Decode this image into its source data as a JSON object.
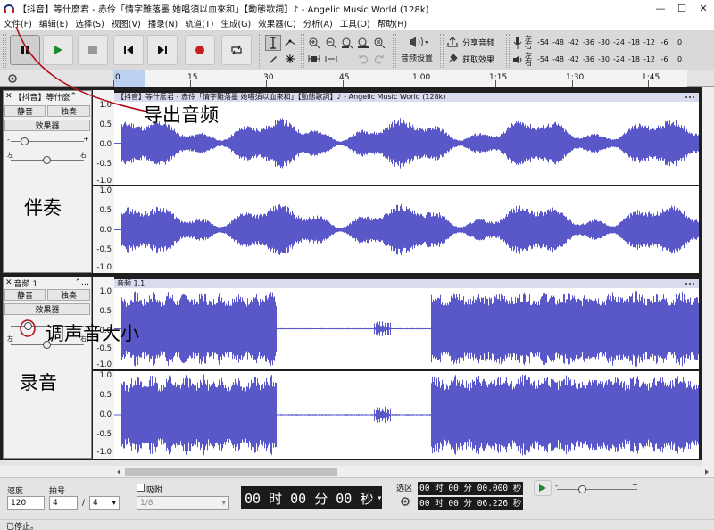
{
  "window": {
    "title": "【抖音】等什麼君 - 赤伶「情字難落墨 她唱須以血來和」【動態歌詞】♪ - Angelic Music World (128k)",
    "minimize": "—",
    "maximize": "☐",
    "close": "✕"
  },
  "menu": [
    "文件(F)",
    "编辑(E)",
    "选择(S)",
    "视图(V)",
    "播录(N)",
    "轨道(T)",
    "生成(G)",
    "效果器(C)",
    "分析(A)",
    "工具(O)",
    "帮助(H)"
  ],
  "toolbar": {
    "share_label": "分享音频",
    "effects_label": "获取效果",
    "audio_setup_label": "音频设置",
    "rec_meter": {
      "l": "左",
      "r": "右",
      "scale": [
        "-54",
        "-48",
        "-42",
        "-36",
        "-30",
        "-24",
        "-18",
        "-12",
        "-6",
        "0"
      ]
    },
    "play_meter": {
      "l": "左",
      "r": "右",
      "scale": [
        "-54",
        "-48",
        "-42",
        "-36",
        "-30",
        "-24",
        "-18",
        "-12",
        "-6",
        "0"
      ]
    }
  },
  "ruler": {
    "ticks": [
      "0",
      "15",
      "30",
      "45",
      "1:00",
      "1:15",
      "1:30",
      "1:45"
    ]
  },
  "tracks": [
    {
      "name": "【抖音】等什麼",
      "clip_title": "【抖音】等什麼君 - 赤伶「情字難落墨 她唱須以血來和」【動態歌詞】♪ - Angelic Music World (128k)",
      "mute": "静音",
      "solo": "独奏",
      "effects": "效果器",
      "pan_left": "左",
      "pan_right": "右",
      "scale_top": [
        "1.0",
        "0.5",
        "0.0",
        "-0.5",
        "-1.0"
      ],
      "scale_bottom": [
        "1.0",
        "0.5",
        "0.0",
        "-0.5",
        "-1.0"
      ]
    },
    {
      "name": "音频 1",
      "clip_title": "音频 1.1",
      "mute": "静音",
      "solo": "独奏",
      "effects": "效果器",
      "pan_left": "左",
      "pan_right": "右",
      "scale_top": [
        "1.0",
        "0.5",
        "0.0",
        "-0.5",
        "-1.0"
      ],
      "scale_bottom": [
        "1.0",
        "0.5",
        "0.0",
        "-0.5",
        "-1.0"
      ]
    }
  ],
  "annotations": {
    "export": "导出音频",
    "accompaniment": "伴奏",
    "volume": "调声音大小",
    "recording": "录音"
  },
  "bottom": {
    "tempo_label": "速度",
    "tempo_value": "120",
    "beat_label": "拍号",
    "beat_num": "4",
    "beat_sep": "/",
    "beat_den": "4",
    "snap_label": "吸附",
    "snap_value": "1/8",
    "time_display": "00 时 00 分 00 秒",
    "sel_label": "选区",
    "sel_start": "00 时 00 分 00.000 秒",
    "sel_end": "00 时 00 分 06.226 秒"
  },
  "status": "已停止。",
  "colors": {
    "wave": "#5a58c8",
    "accent": "#2b66d4",
    "annotation_red": "#c0141c"
  }
}
